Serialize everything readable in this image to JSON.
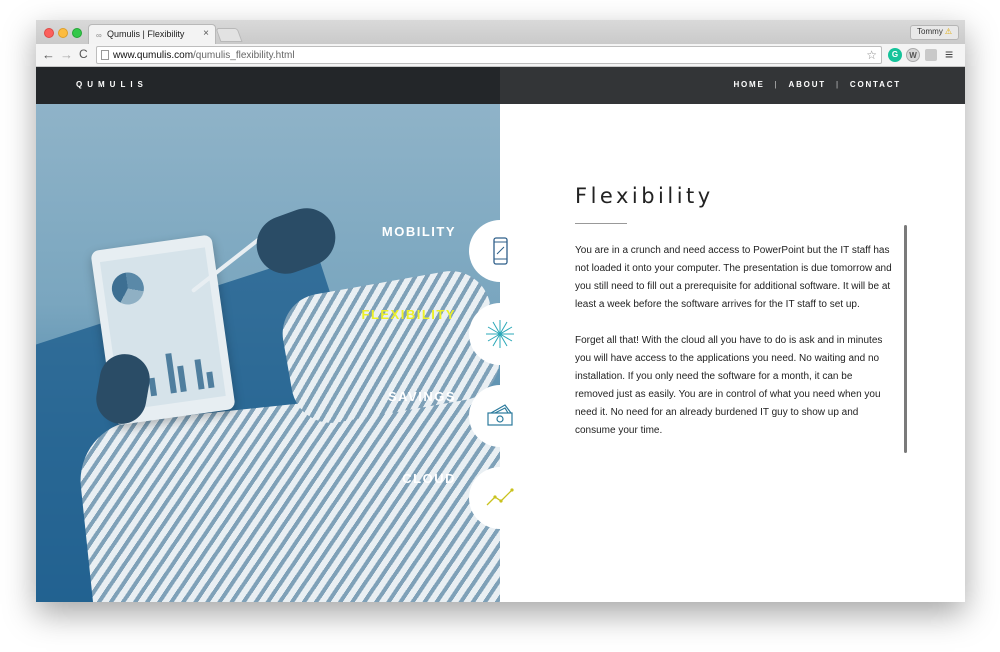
{
  "browser": {
    "tab_title": "Qumulis | Flexibility",
    "tab_close": "×",
    "user_name": "Tommy",
    "user_warning": "⚠",
    "url_host": "www.qumulis.com",
    "url_path": "/qumulis_flexibility.html",
    "back": "←",
    "forward": "→",
    "reload": "C",
    "star": "☆",
    "menu": "≡",
    "ext_grammarly": "G",
    "ext_w": "W"
  },
  "site": {
    "logo": "QUMULIS",
    "nav": [
      {
        "label": "HOME"
      },
      {
        "label": "ABOUT"
      },
      {
        "label": "CONTACT"
      }
    ],
    "nav_separator": "|"
  },
  "features": [
    {
      "label": "MOBILITY",
      "icon": "phone-icon",
      "active": false
    },
    {
      "label": "FLEXIBILITY",
      "icon": "burst-icon",
      "active": true
    },
    {
      "label": "SAVINGS",
      "icon": "money-icon",
      "active": false
    },
    {
      "label": "CLOUD",
      "icon": "trend-line-icon",
      "active": false
    }
  ],
  "colors": {
    "active_feature": "#ecf02a",
    "icon_stroke": "#2b7a9c",
    "header_dark": "#232629"
  },
  "content": {
    "title": "Flexibility",
    "paragraphs": [
      "You are in a crunch and need access to PowerPoint but the IT staff has not loaded it onto your computer. The presentation is due tomorrow and you still need to fill out a prerequisite for additional software. It will be at least a week before the software arrives for the IT staff to set up.",
      "Forget all that! With the cloud all you have to do is ask and in minutes you will have access to the applications you need. No waiting and no installation. If you only need the software for a month, it can be removed just as easily. You are in control of what you need when you need it. No need for an already burdened IT guy to show up and consume your time."
    ]
  }
}
